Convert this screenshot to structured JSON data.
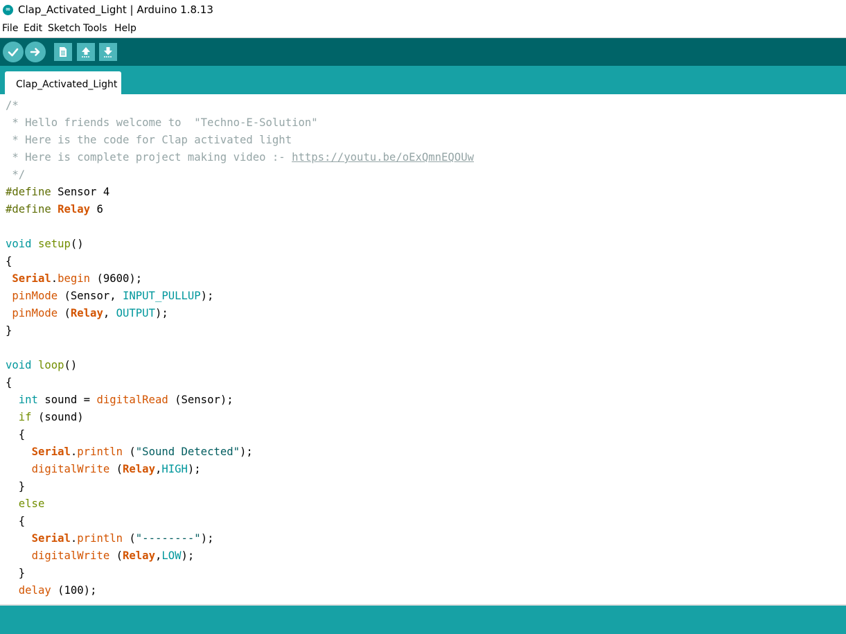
{
  "window": {
    "title": "Clap_Activated_Light | Arduino 1.8.13",
    "icon": "arduino-infinity-icon"
  },
  "menu": [
    "File",
    "Edit",
    "Sketch",
    "Tools",
    "Help"
  ],
  "toolbar": {
    "buttons": [
      {
        "name": "verify-button",
        "icon": "checkmark-icon"
      },
      {
        "name": "upload-button",
        "icon": "arrow-right-icon"
      },
      {
        "name": "new-button",
        "icon": "new-file-icon"
      },
      {
        "name": "open-button",
        "icon": "arrow-up-icon"
      },
      {
        "name": "save-button",
        "icon": "arrow-down-icon"
      }
    ]
  },
  "tabs": [
    {
      "label": "Clap_Activated_Light",
      "active": true
    }
  ],
  "colors": {
    "toolbar_bg": "#006468",
    "tabbar_bg": "#17a1a5",
    "button_bg": "#4db7bb",
    "comment": "#95a5a6",
    "keyword_orange": "#d35400",
    "type_teal": "#00979c"
  },
  "editor": {
    "lines": [
      [
        [
          "comment",
          "/*"
        ]
      ],
      [
        [
          "comment",
          " * Hello friends welcome to  \"Techno-E-Solution\""
        ]
      ],
      [
        [
          "comment",
          " * Here is the code for Clap activated light"
        ]
      ],
      [
        [
          "comment",
          " * Here is complete project making video :- "
        ],
        [
          "url",
          "https://youtu.be/oExQmnEQOUw"
        ]
      ],
      [
        [
          "comment",
          " */"
        ]
      ],
      [
        [
          "pre",
          "#define"
        ],
        [
          "plain",
          " Sensor 4"
        ]
      ],
      [
        [
          "pre",
          "#define"
        ],
        [
          "plain",
          " "
        ],
        [
          "class",
          "Relay"
        ],
        [
          "plain",
          " 6"
        ]
      ],
      [],
      [
        [
          "type",
          "void"
        ],
        [
          "plain",
          " "
        ],
        [
          "kw",
          "setup"
        ],
        [
          "plain",
          "()"
        ]
      ],
      [
        [
          "plain",
          "{"
        ]
      ],
      [
        [
          "plain",
          " "
        ],
        [
          "class",
          "Serial"
        ],
        [
          "plain",
          "."
        ],
        [
          "func",
          "begin"
        ],
        [
          "plain",
          " (9600);"
        ]
      ],
      [
        [
          "plain",
          " "
        ],
        [
          "func",
          "pinMode"
        ],
        [
          "plain",
          " (Sensor, "
        ],
        [
          "const",
          "INPUT_PULLUP"
        ],
        [
          "plain",
          ");"
        ]
      ],
      [
        [
          "plain",
          " "
        ],
        [
          "func",
          "pinMode"
        ],
        [
          "plain",
          " ("
        ],
        [
          "class",
          "Relay"
        ],
        [
          "plain",
          ", "
        ],
        [
          "const",
          "OUTPUT"
        ],
        [
          "plain",
          ");"
        ]
      ],
      [
        [
          "plain",
          "}"
        ]
      ],
      [],
      [
        [
          "type",
          "void"
        ],
        [
          "plain",
          " "
        ],
        [
          "kw",
          "loop"
        ],
        [
          "plain",
          "()"
        ]
      ],
      [
        [
          "plain",
          "{"
        ]
      ],
      [
        [
          "plain",
          "  "
        ],
        [
          "type",
          "int"
        ],
        [
          "plain",
          " sound = "
        ],
        [
          "func",
          "digitalRead"
        ],
        [
          "plain",
          " (Sensor);"
        ]
      ],
      [
        [
          "plain",
          "  "
        ],
        [
          "kw",
          "if"
        ],
        [
          "plain",
          " (sound)"
        ]
      ],
      [
        [
          "plain",
          "  {"
        ]
      ],
      [
        [
          "plain",
          "    "
        ],
        [
          "class",
          "Serial"
        ],
        [
          "plain",
          "."
        ],
        [
          "func",
          "println"
        ],
        [
          "plain",
          " ("
        ],
        [
          "str",
          "\"Sound Detected\""
        ],
        [
          "plain",
          ");"
        ]
      ],
      [
        [
          "plain",
          "    "
        ],
        [
          "func",
          "digitalWrite"
        ],
        [
          "plain",
          " ("
        ],
        [
          "class",
          "Relay"
        ],
        [
          "plain",
          ","
        ],
        [
          "const",
          "HIGH"
        ],
        [
          "plain",
          ");"
        ]
      ],
      [
        [
          "plain",
          "  }"
        ]
      ],
      [
        [
          "plain",
          "  "
        ],
        [
          "kw",
          "else"
        ]
      ],
      [
        [
          "plain",
          "  {"
        ]
      ],
      [
        [
          "plain",
          "    "
        ],
        [
          "class",
          "Serial"
        ],
        [
          "plain",
          "."
        ],
        [
          "func",
          "println"
        ],
        [
          "plain",
          " ("
        ],
        [
          "str",
          "\"--------\""
        ],
        [
          "plain",
          ");"
        ]
      ],
      [
        [
          "plain",
          "    "
        ],
        [
          "func",
          "digitalWrite"
        ],
        [
          "plain",
          " ("
        ],
        [
          "class",
          "Relay"
        ],
        [
          "plain",
          ","
        ],
        [
          "const",
          "LOW"
        ],
        [
          "plain",
          ");"
        ]
      ],
      [
        [
          "plain",
          "  }"
        ]
      ],
      [
        [
          "plain",
          "  "
        ],
        [
          "func",
          "delay"
        ],
        [
          "plain",
          " (100);"
        ]
      ]
    ]
  }
}
